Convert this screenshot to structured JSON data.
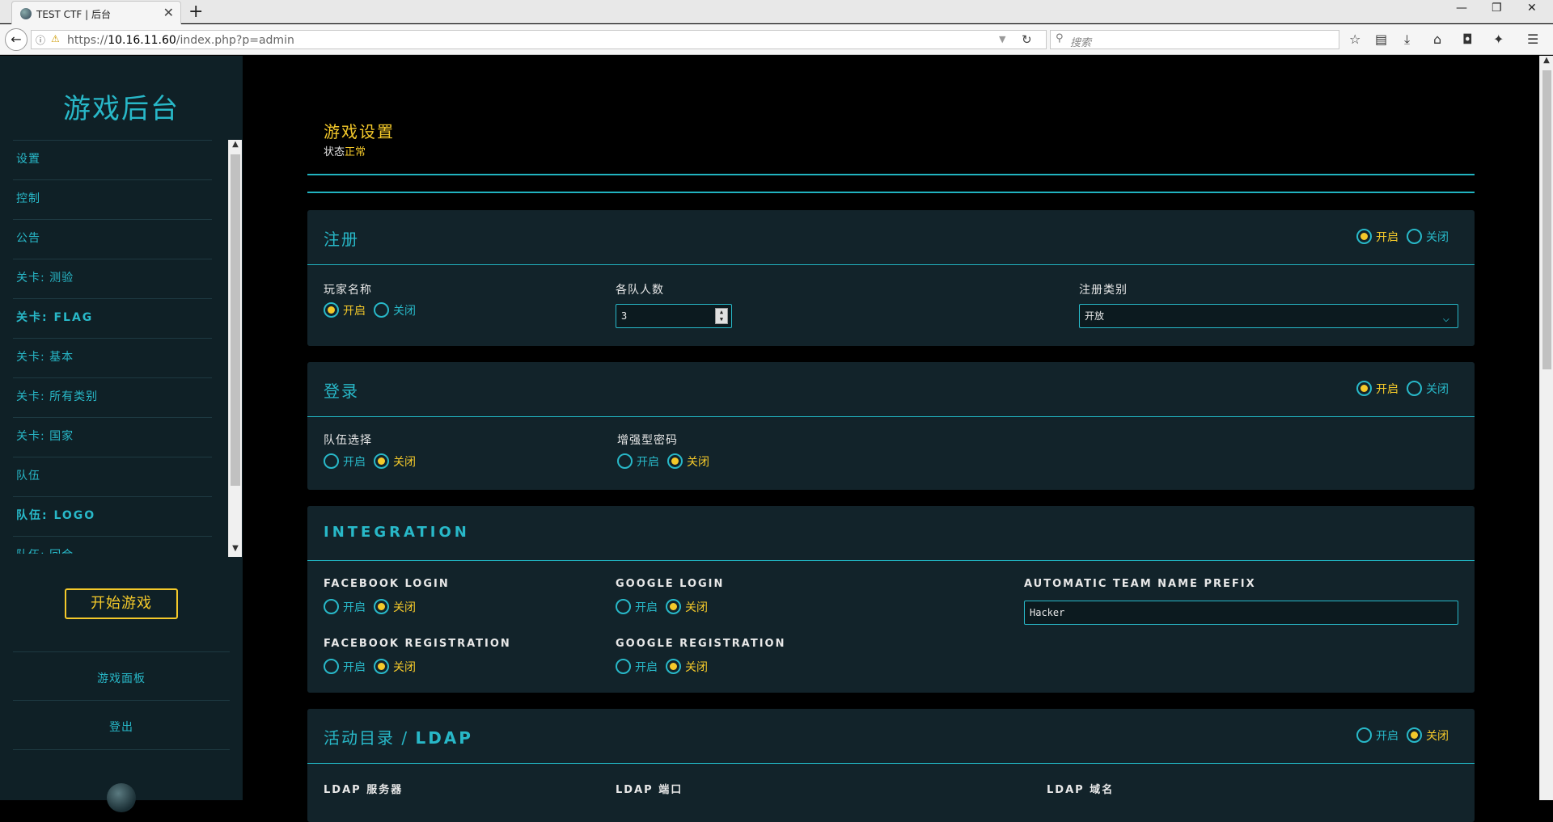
{
  "browser": {
    "tab_title": "TEST CTF | 后台",
    "tab_close": "✕",
    "new_tab": "+",
    "url_prefix": "https://",
    "url_host": "10.16.11.60",
    "url_path": "/index.php?p=admin",
    "search_placeholder": "搜索",
    "win_min": "—",
    "win_max": "❐",
    "win_close": "✕"
  },
  "sidebar": {
    "title": "游戏后台",
    "items": [
      {
        "label": "设置"
      },
      {
        "label": "控制"
      },
      {
        "label": "公告"
      },
      {
        "label": "关卡: 测验"
      },
      {
        "label": "关卡: FLAG"
      },
      {
        "label": "关卡: 基本"
      },
      {
        "label": "关卡: 所有类别"
      },
      {
        "label": "关卡: 国家"
      },
      {
        "label": "队伍"
      },
      {
        "label": "队伍: LOGO"
      },
      {
        "label": "队伍: 回合"
      }
    ],
    "start_button": "开始游戏",
    "game_board": "游戏面板",
    "logout": "登出"
  },
  "page": {
    "title": "游戏设置",
    "status_label": "状态",
    "status_value": "正常"
  },
  "radio_labels": {
    "on": "开启",
    "off": "关闭"
  },
  "registration": {
    "title": "注册",
    "player_name_label": "玩家名称",
    "team_size_label": "各队人数",
    "team_size_value": "3",
    "reg_type_label": "注册类别",
    "reg_type_value": "开放"
  },
  "login": {
    "title": "登录",
    "team_select_label": "队伍选择",
    "strong_password_label": "增强型密码"
  },
  "integration": {
    "title": "INTEGRATION",
    "facebook_login_label": "FACEBOOK LOGIN",
    "google_login_label": "GOOGLE LOGIN",
    "team_prefix_label": "AUTOMATIC TEAM NAME PREFIX",
    "team_prefix_value": "Hacker",
    "facebook_reg_label": "FACEBOOK REGISTRATION",
    "google_reg_label": "GOOGLE REGISTRATION"
  },
  "ldap": {
    "title_cn": "活动目录 / ",
    "title_en": "LDAP",
    "server_label": "LDAP 服务器",
    "port_label": "LDAP 端口",
    "domain_label": "LDAP 域名"
  },
  "colors": {
    "accent": "#28b8c8",
    "highlight": "#f4c92a",
    "panel_bg": "#12232a",
    "sidebar_bg": "#0f2026"
  }
}
